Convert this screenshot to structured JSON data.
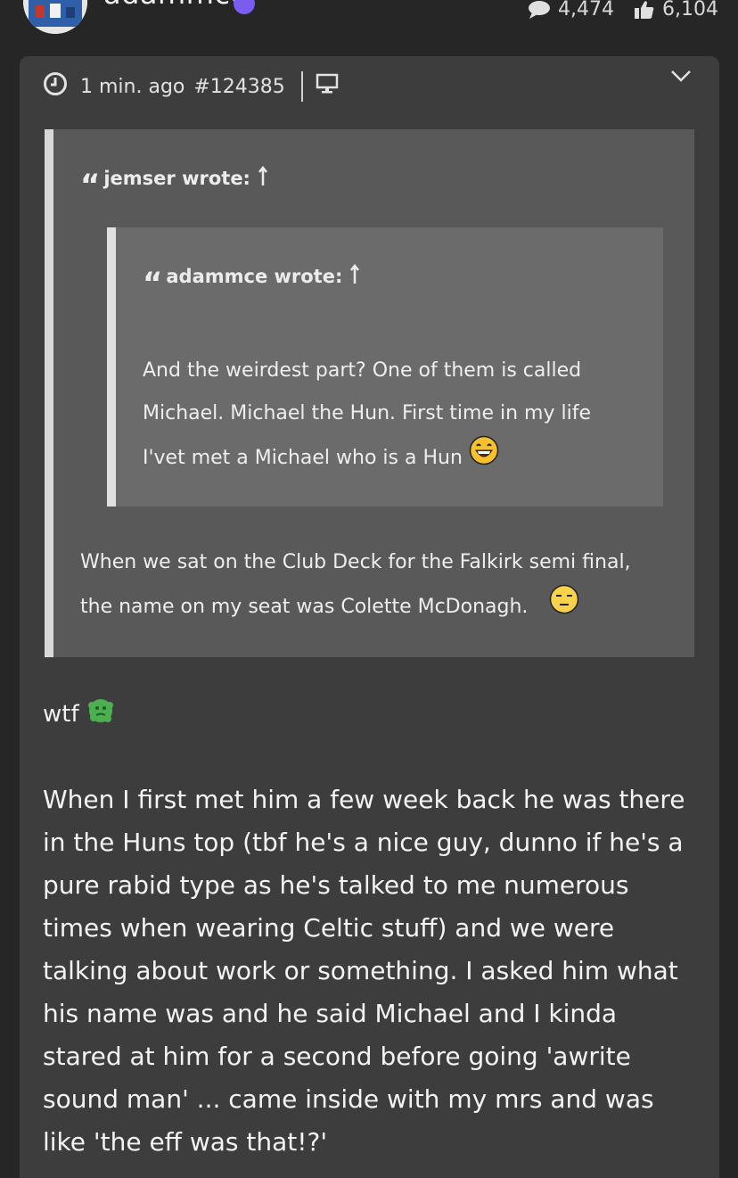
{
  "header": {
    "username": "adammce",
    "comments_count": "4,474",
    "likes_count": "6,104",
    "comments_icon": "speech-bubble-icon",
    "likes_icon": "thumbs-up-icon",
    "online_color": "#7b5cf0"
  },
  "post": {
    "time": "1 min. ago",
    "post_id": "#124385",
    "device_icon": "desktop-icon",
    "expand_icon": "chevron-down-icon",
    "outer_quote": {
      "author": "jemser wrote:",
      "lines": [
        "When we sat on the Club Deck for the Falkirk semi final,",
        "the name on my seat was Colette McDonagh."
      ],
      "emoji": "unamused-face-emoji"
    },
    "inner_quote": {
      "author": "adammce wrote:",
      "lines": [
        "And the weirdest part? One of them is called",
        "Michael. Michael the Hun. First time in my life",
        "I'vet met a Michael who is a Hun"
      ],
      "emoji": "laughing-face-emoji"
    },
    "short_reply": "wtf",
    "short_reply_emoji": "green-sick-face-emoji",
    "body_lines": [
      "When I first met him a few week back he was there",
      "in the Huns top (tbf he's a nice guy, dunno if he's a",
      "pure rabid type as he's talked to me numerous",
      "times when wearing Celtic stuff) and we were",
      "talking about work or something. I asked him what",
      "his name was and he said Michael and I kinda",
      "stared at him for a second before going 'awrite",
      "sound man' ... came inside with my mrs and was",
      "like 'the eff was that!?'"
    ]
  }
}
